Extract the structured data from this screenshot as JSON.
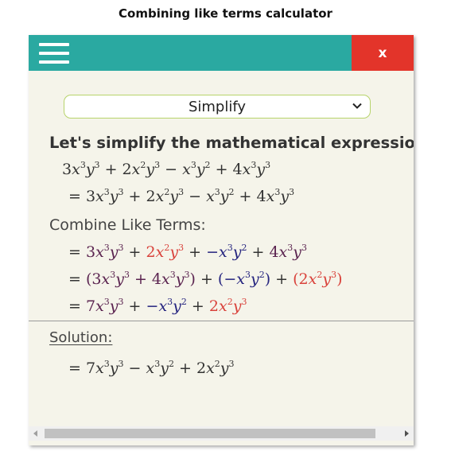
{
  "page": {
    "title": "Combining like terms calculator"
  },
  "toolbar": {
    "close_label": "x"
  },
  "mode_select": {
    "value": "Simplify"
  },
  "content": {
    "heading": "Let's simplify the mathematical expression",
    "combine_label": "Combine Like Terms:",
    "solution_label": "Solution:"
  },
  "colors": {
    "topbar": "#2aa9a1",
    "close_button": "#e3342a",
    "panel_background": "#f5f4ea",
    "term_purple": "#5b2450",
    "term_red": "#d9423b",
    "term_blue": "#25247f"
  }
}
